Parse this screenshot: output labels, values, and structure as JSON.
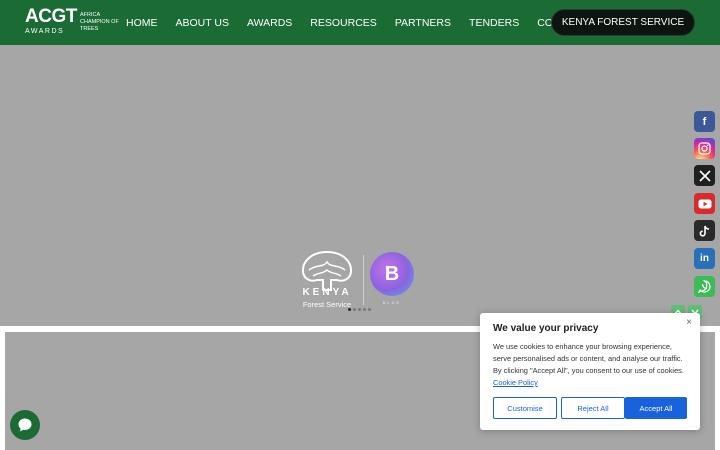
{
  "header": {
    "logo": {
      "main": "ACGT",
      "sub": "AWARDS",
      "tagline": "Africa Champion of Trees"
    },
    "nav": [
      "HOME",
      "ABOUT US",
      "AWARDS",
      "RESOURCES",
      "PARTNERS",
      "TENDERS",
      "CONTACTS"
    ],
    "cta_label": "KENYA FOREST SERVICE"
  },
  "hero": {
    "kfs_name": "KENYA",
    "kfs_sub": "Forest Service",
    "partner_letter": "B",
    "partner_text": "BLUE",
    "slides_total": 5,
    "slide_active": 1
  },
  "social": {
    "facebook": "f",
    "linkedin": "in"
  },
  "cookie": {
    "title": "We value your privacy",
    "text": "We use cookies to enhance your browsing experience, serve personalised ads or content, and analyse our traffic. By clicking \"Accept All\", you consent to our use of cookies.",
    "link": "Cookie Policy",
    "close": "×",
    "customise": "Customise",
    "reject": "Reject All",
    "accept": "Accept All"
  },
  "colors": {
    "header_bg": "#1a6b34",
    "hero_bg": "#a6a6a6",
    "accent_blue": "#1863dc"
  }
}
